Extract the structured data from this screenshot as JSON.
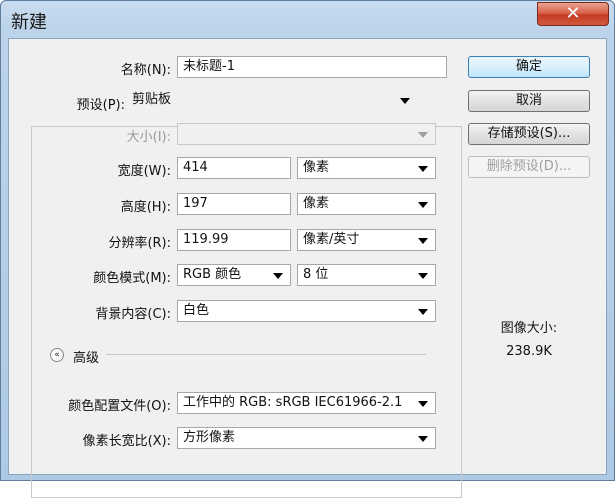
{
  "window": {
    "title": "新建",
    "close_glyph": "✕"
  },
  "form": {
    "name": {
      "label": "名称(N):",
      "value": "未标题-1"
    },
    "preset": {
      "label": "预设(P):",
      "value": "剪贴板"
    },
    "size": {
      "label": "大小(I):",
      "value": ""
    },
    "width": {
      "label": "宽度(W):",
      "value": "414",
      "unit": "像素"
    },
    "height": {
      "label": "高度(H):",
      "value": "197",
      "unit": "像素"
    },
    "resolution": {
      "label": "分辨率(R):",
      "value": "119.99",
      "unit": "像素/英寸"
    },
    "color_mode": {
      "label": "颜色模式(M):",
      "value": "RGB 颜色",
      "depth": "8 位"
    },
    "background": {
      "label": "背景内容(C):",
      "value": "白色"
    },
    "advanced": {
      "label": "高级",
      "toggle_glyph": "«"
    },
    "color_profile": {
      "label": "颜色配置文件(O):",
      "value": "工作中的 RGB: sRGB IEC61966-2.1"
    },
    "pixel_aspect": {
      "label": "像素长宽比(X):",
      "value": "方形像素"
    }
  },
  "buttons": {
    "ok": "确定",
    "cancel": "取消",
    "save_preset": "存储预设(S)...",
    "delete_preset": "删除预设(D)..."
  },
  "image_size": {
    "label": "图像大小:",
    "value": "238.9K"
  }
}
